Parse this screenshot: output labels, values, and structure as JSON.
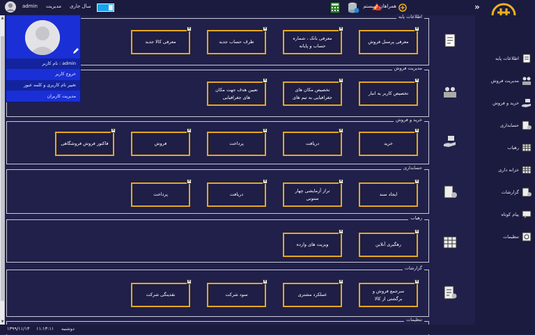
{
  "topbar": {
    "username": "admin",
    "role": "مدیریت",
    "fiscal_year_label": "سال جاری",
    "system_partners": "همراهان سیستم"
  },
  "popup": {
    "username_line": "نام کاربر : admin",
    "items": [
      "خروج کاربر",
      "تغییر نام کاربری و کلمه عبور",
      "مدیریت کاربران"
    ]
  },
  "sections": [
    {
      "title": "اطلاعات پایه",
      "cards": [
        "معرفی پرسنل فروش",
        "معرفی بانک ، شماره حساب و پایانه",
        "طرف حساب جدید",
        "معرفی کالا جدید"
      ]
    },
    {
      "title": "مدیریت فروش",
      "cards": [
        "تخصیص کاربر به انبار",
        "تخصیص مکان های جغرافیایی به تیم های",
        "تعیین هدف جهت مکان های جغرافیایی"
      ]
    },
    {
      "title": "خرید و فروش",
      "cards": [
        "خرید",
        "دریافت",
        "پرداخت",
        "فروش",
        "فاکتور فروش فروشگاهی"
      ]
    },
    {
      "title": "حسابداری",
      "cards": [
        "ایجاد سند",
        "تراز آزمایشی چهار ستونی",
        "دریافت",
        "پرداخت"
      ]
    },
    {
      "title": "رهیاب",
      "cards": [
        "رهگیری آنلاین",
        "ویزیت های وارده"
      ]
    },
    {
      "title": "گزارشات",
      "cards": [
        "سرجمع فروش و برگشتی از کالا",
        "عملکرد مشتری",
        "سود شرکت",
        "نقدینگی شرکت"
      ]
    },
    {
      "title": "تنظیمات",
      "cards": []
    }
  ],
  "sidebar": {
    "items": [
      {
        "label": "اطلاعات پایه",
        "icon": "info-card-icon"
      },
      {
        "label": "مدیریت فروش",
        "icon": "sales-team-icon"
      },
      {
        "label": "خرید و فروش",
        "icon": "cart-hand-icon"
      },
      {
        "label": "حسابداری",
        "icon": "ledger-icon"
      },
      {
        "label": "رهیاب",
        "icon": "tracker-icon"
      },
      {
        "label": "خزانه داری",
        "icon": "treasury-icon"
      },
      {
        "label": "گزارشات",
        "icon": "report-icon"
      },
      {
        "label": "پیام کوتاه",
        "icon": "sms-icon"
      },
      {
        "label": "تنظیمات",
        "icon": "settings-icon"
      }
    ]
  },
  "statusbar": {
    "day": "دوشنبه",
    "time": "۱۱:۱۳:۱۱",
    "date": "۱۳۹۹/۱۱/۱۳"
  },
  "colors": {
    "card_border": "#e8a81c",
    "background": "#20204a",
    "popup": "#1a2fd6"
  }
}
